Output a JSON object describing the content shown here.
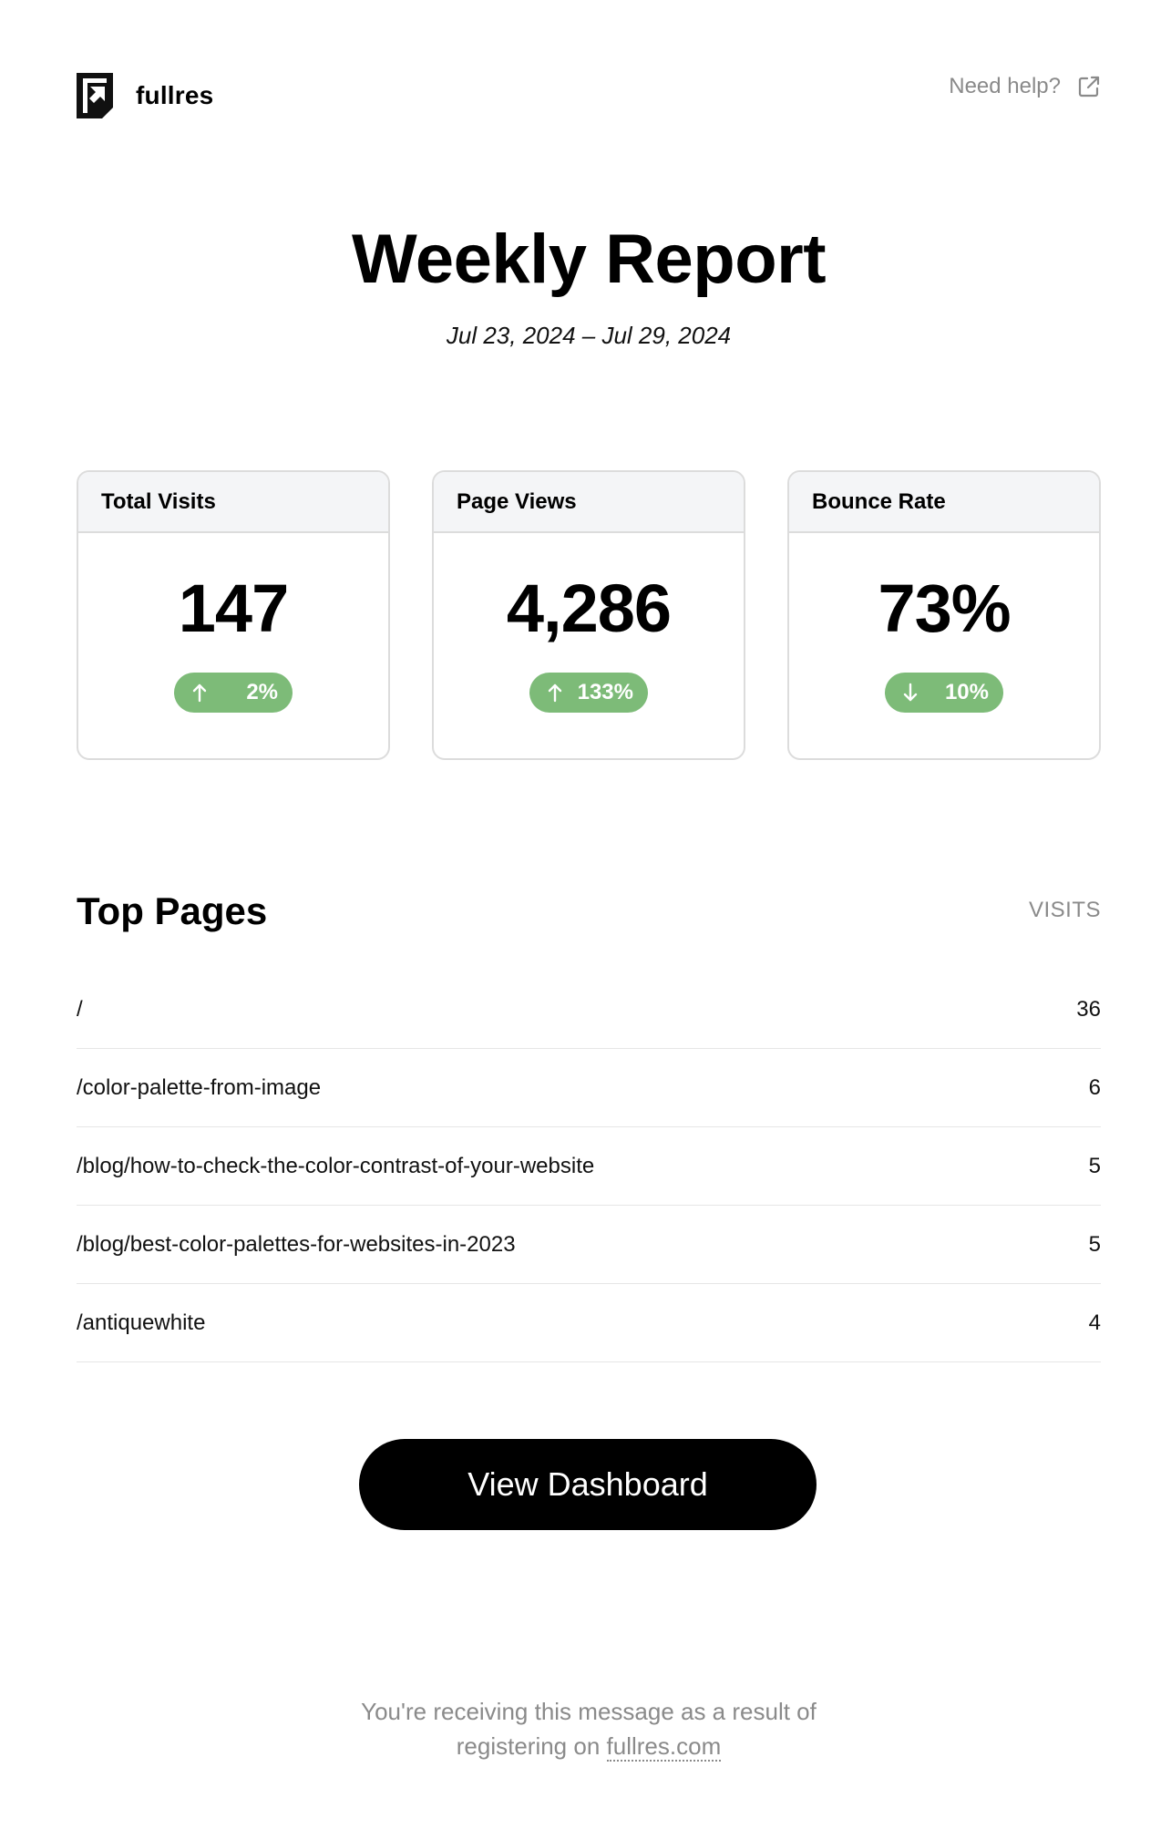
{
  "header": {
    "brand_name": "fullres",
    "help_label": "Need help?"
  },
  "report": {
    "title": "Weekly Report",
    "date_range": "Jul 23, 2024 – Jul 29, 2024"
  },
  "stats": [
    {
      "label": "Total Visits",
      "value": "147",
      "change": "2%",
      "direction": "up"
    },
    {
      "label": "Page Views",
      "value": "4,286",
      "change": "133%",
      "direction": "up"
    },
    {
      "label": "Bounce Rate",
      "value": "73%",
      "change": "10%",
      "direction": "down"
    }
  ],
  "top_pages": {
    "title": "Top Pages",
    "column_label": "VISITS",
    "rows": [
      {
        "path": "/",
        "visits": "36"
      },
      {
        "path": "/color-palette-from-image",
        "visits": "6"
      },
      {
        "path": "/blog/how-to-check-the-color-contrast-of-your-website",
        "visits": "5"
      },
      {
        "path": "/blog/best-color-palettes-for-websites-in-2023",
        "visits": "5"
      },
      {
        "path": "/antiquewhite",
        "visits": "4"
      }
    ]
  },
  "cta": {
    "label": "View Dashboard"
  },
  "footer": {
    "line1": "You're receiving this message as a result of",
    "line2_prefix": "registering on",
    "link_text": "fullres.com"
  },
  "colors": {
    "badge_green": "#7dbb78",
    "card_header_bg": "#f4f5f7",
    "muted_text": "#8a8a8a",
    "button_bg": "#000000"
  },
  "icons": {
    "logo": "fullres-logo-icon",
    "help": "external-link-icon",
    "up": "arrow-up-icon",
    "down": "arrow-down-icon"
  }
}
